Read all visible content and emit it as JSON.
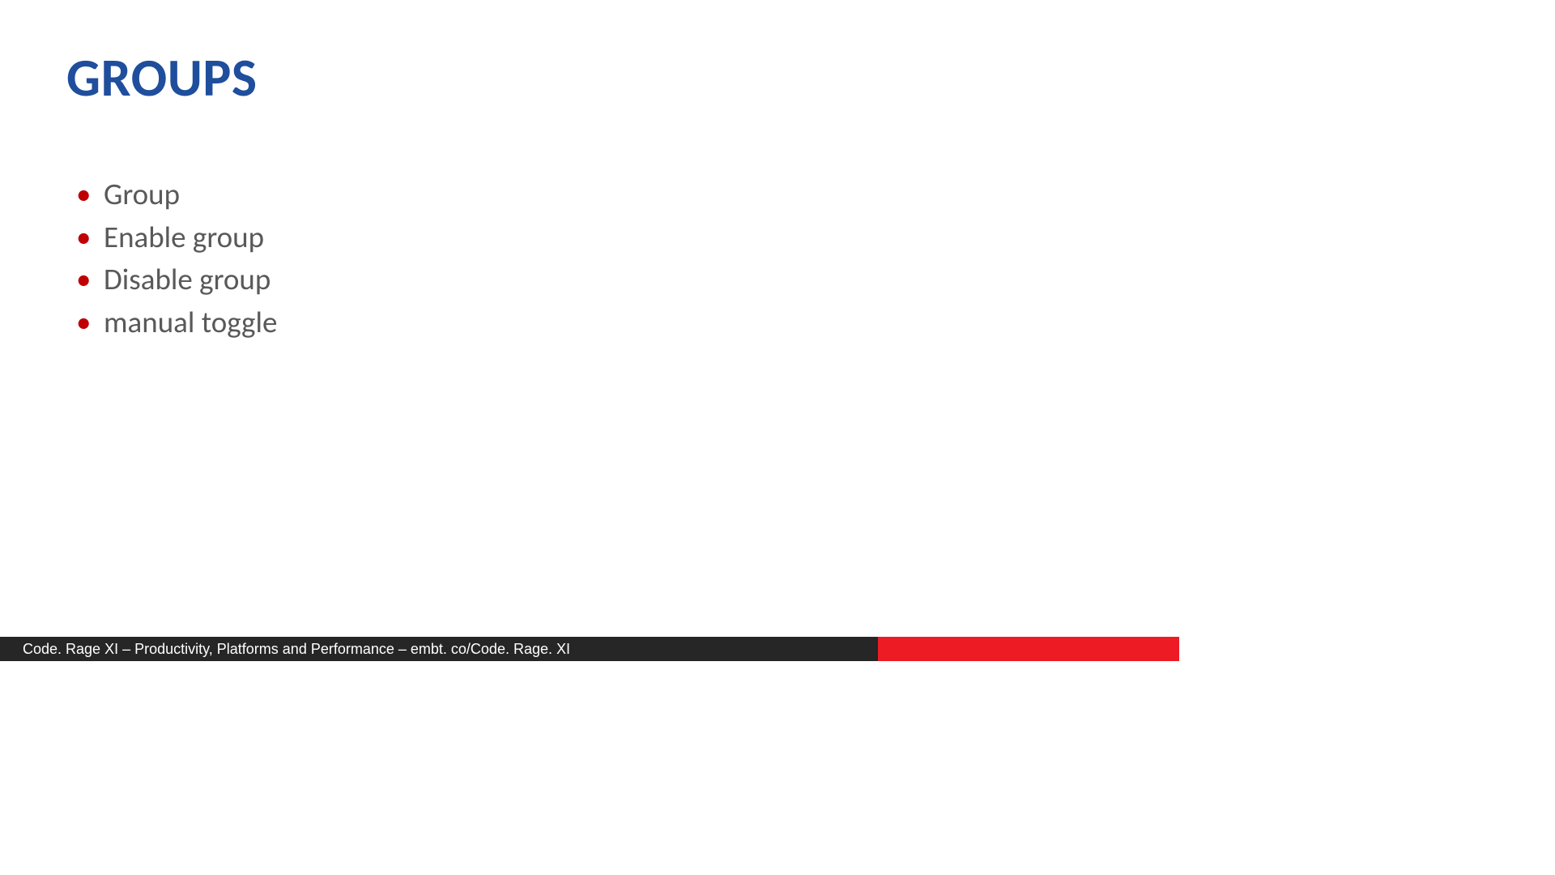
{
  "title": "GROUPS",
  "bullets": [
    "Group",
    "Enable group",
    "Disable group",
    "manual toggle"
  ],
  "footer": {
    "text": "Code. Rage XI – Productivity, Platforms and Performance – embt. co/Code. Rage. XI"
  },
  "colors": {
    "title": "#1F4E9C",
    "bullet_marker": "#C00000",
    "bullet_text": "#595959",
    "footer_dark": "#262626",
    "footer_red": "#ED1C24"
  }
}
